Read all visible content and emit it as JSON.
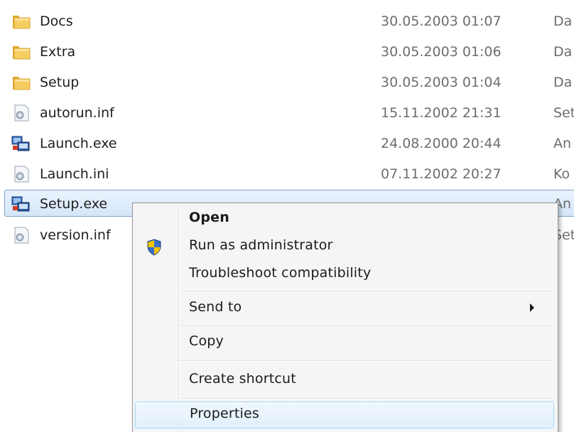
{
  "files": [
    {
      "name": "Docs",
      "date": "30.05.2003 01:07",
      "type": "Da",
      "icon": "folder-icon"
    },
    {
      "name": "Extra",
      "date": "30.05.2003 01:06",
      "type": "Da",
      "icon": "folder-icon"
    },
    {
      "name": "Setup",
      "date": "30.05.2003 01:04",
      "type": "Da",
      "icon": "folder-icon"
    },
    {
      "name": "autorun.inf",
      "date": "15.11.2002 21:31",
      "type": "Set",
      "icon": "settings-file-icon"
    },
    {
      "name": "Launch.exe",
      "date": "24.08.2000 20:44",
      "type": "An",
      "icon": "application-icon"
    },
    {
      "name": "Launch.ini",
      "date": "07.11.2002 20:27",
      "type": "Ko",
      "icon": "settings-file-icon"
    },
    {
      "name": "Setup.exe",
      "date": "",
      "type": "An",
      "icon": "application-icon",
      "selected": true
    },
    {
      "name": "version.inf",
      "date": "",
      "type": "Set",
      "icon": "settings-file-icon"
    }
  ],
  "context_menu": {
    "open": "Open",
    "run_as_admin": "Run as administrator",
    "troubleshoot": "Troubleshoot compatibility",
    "send_to": "Send to",
    "copy": "Copy",
    "create_shortcut": "Create shortcut",
    "properties": "Properties"
  },
  "colors": {
    "selection_border": "#7da2ce",
    "hover_border": "#a8d8f9",
    "menu_background": "#f5f5f5",
    "folder": "#f2c55c",
    "shield_blue": "#3a6fc8",
    "shield_yellow": "#f5c400"
  }
}
